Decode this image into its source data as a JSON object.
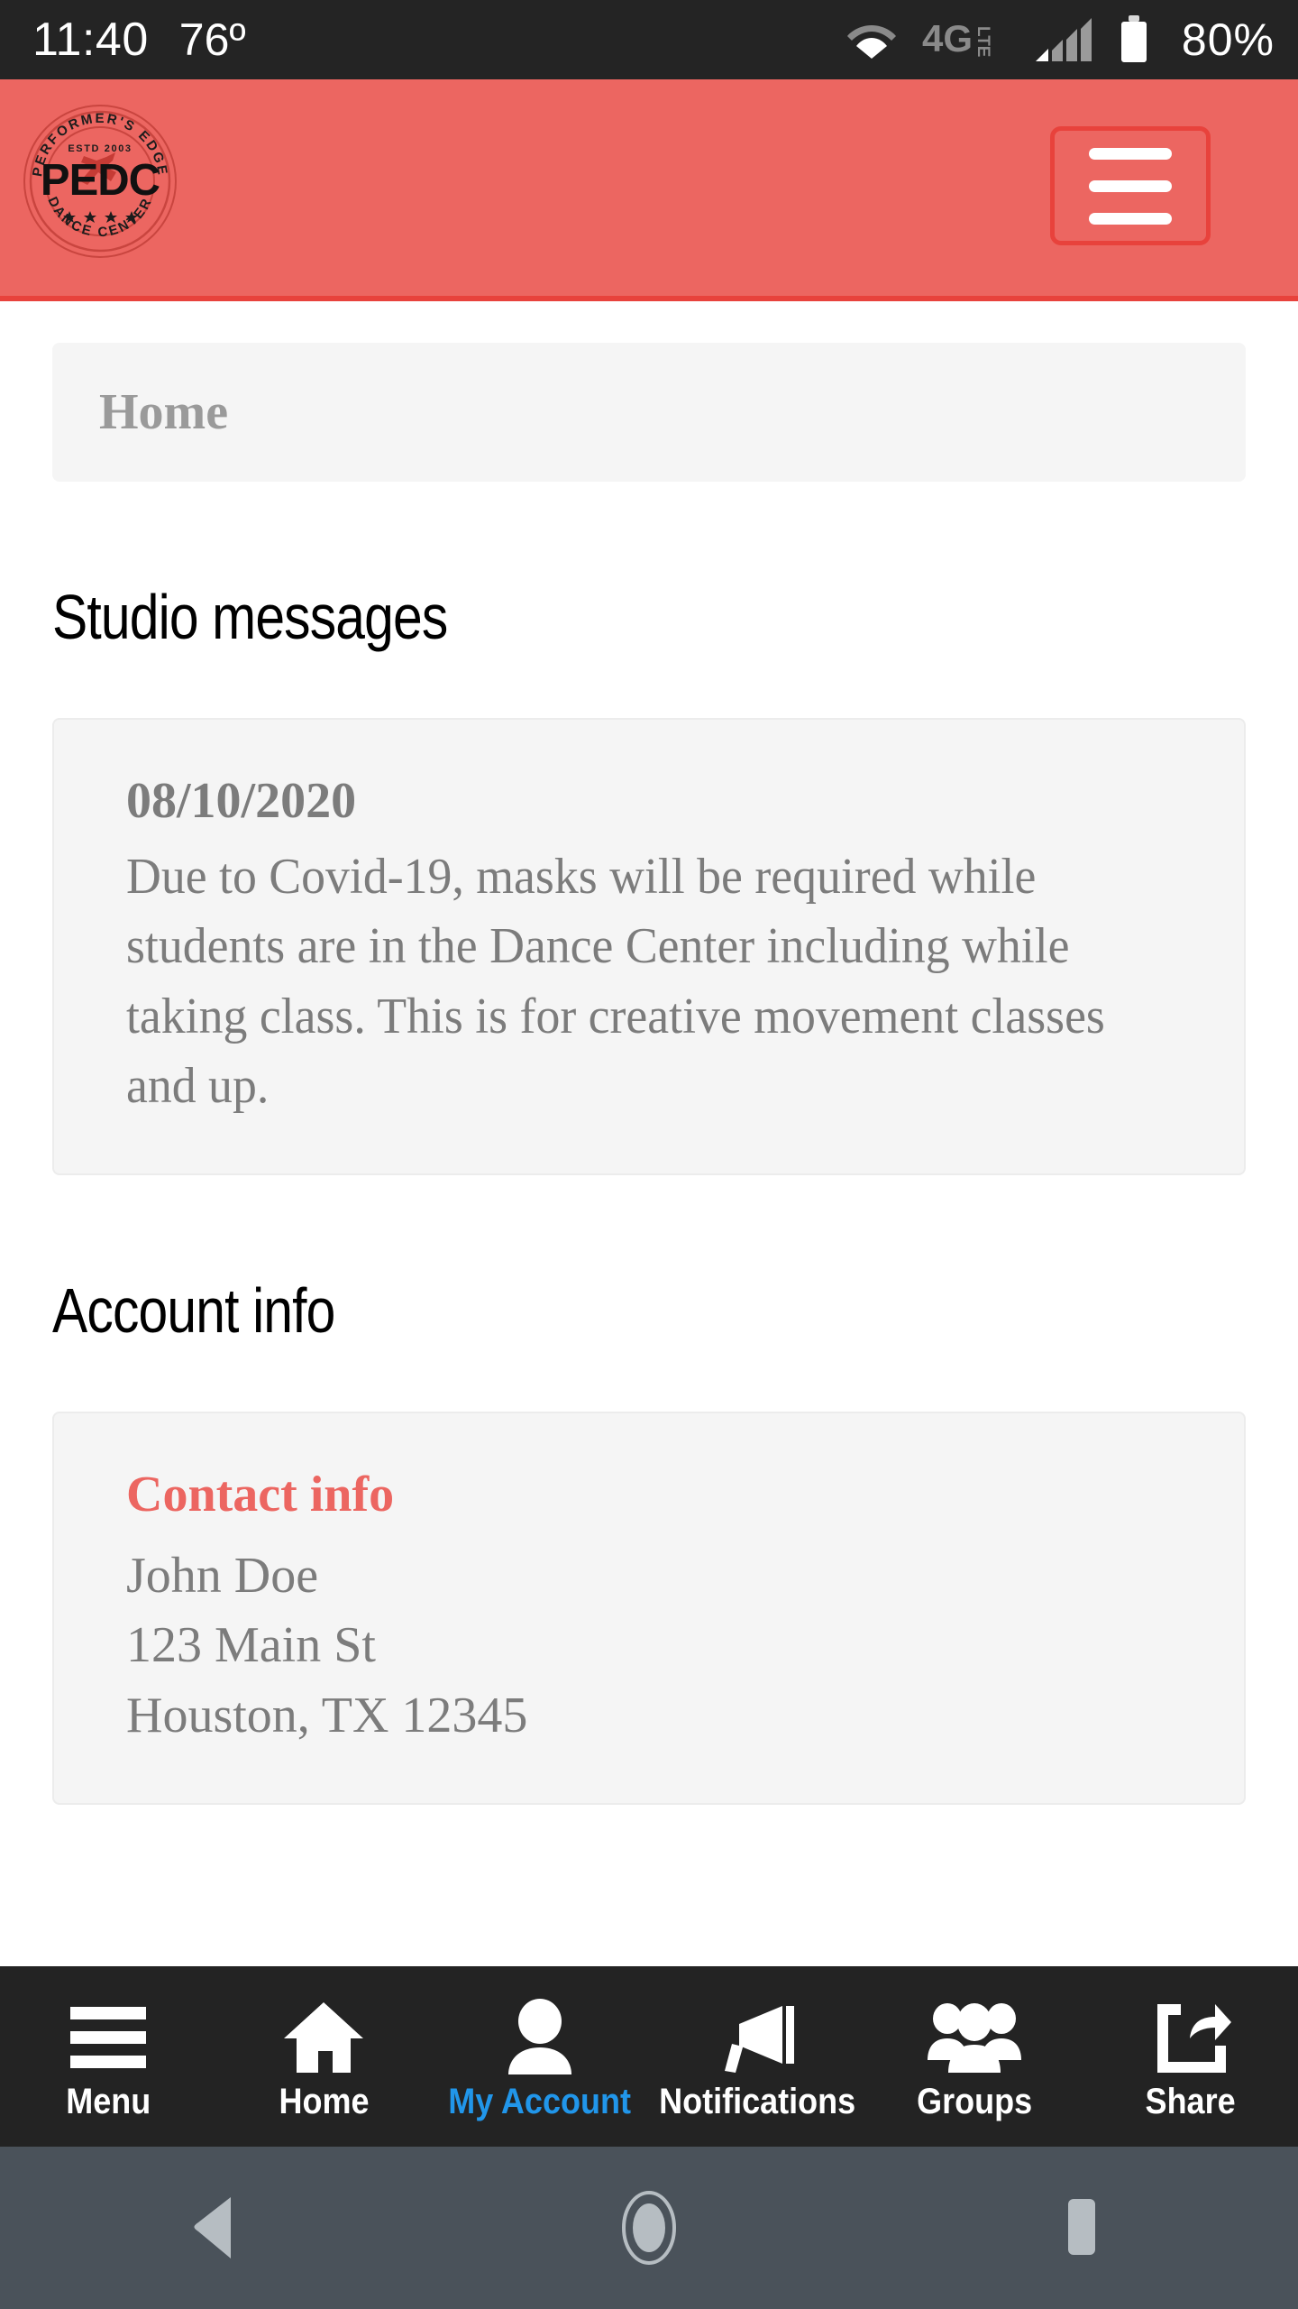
{
  "status_bar": {
    "time": "11:40",
    "temperature": "76º",
    "battery_percent": "80%",
    "network_label": "4G",
    "network_sub": "LTE",
    "icons": {
      "wifi": "wifi-icon",
      "network": "4g-lte-icon",
      "signal": "signal-bars-icon",
      "battery": "battery-icon"
    },
    "bg_color": "#242424"
  },
  "app_header": {
    "bg_color": "#ec6661",
    "border_color": "#e8423c",
    "logo": {
      "name": "pedc-logo",
      "initials": "PEDC",
      "top_arc": "PERFORMER'S EDGE",
      "bottom_arc": "DANCE CENTER",
      "established": "ESTD 2003",
      "stars": 4
    },
    "menu_button_label": "Menu"
  },
  "breadcrumb": {
    "label": "Home"
  },
  "sections": [
    {
      "title": "Studio messages",
      "card": {
        "date": "08/10/2020",
        "body": "Due to Covid-19, masks will be required while students are in the Dance Center including while taking class. This is for creative movement classes and up."
      }
    },
    {
      "title": "Account info",
      "card": {
        "heading": "Contact info",
        "heading_color": "#ec6661",
        "lines": [
          "John Doe",
          "123 Main St",
          "Houston, TX 12345"
        ]
      }
    }
  ],
  "bottom_nav": {
    "active_color": "#2196ea",
    "bg_color": "#232323",
    "items": [
      {
        "label": "Menu",
        "icon": "hamburger-icon",
        "active": false
      },
      {
        "label": "Home",
        "icon": "house-icon",
        "active": false
      },
      {
        "label": "My Account",
        "icon": "person-icon",
        "active": true
      },
      {
        "label": "Notifications",
        "icon": "megaphone-icon",
        "active": false
      },
      {
        "label": "Groups",
        "icon": "people-group-icon",
        "active": false
      },
      {
        "label": "Share",
        "icon": "share-arrow-icon",
        "active": false
      }
    ]
  },
  "system_nav": {
    "bg_color": "#4a525a",
    "buttons": [
      {
        "name": "back-button",
        "icon": "triangle-back-icon"
      },
      {
        "name": "home-button",
        "icon": "circle-home-icon"
      },
      {
        "name": "recents-button",
        "icon": "square-recents-icon"
      }
    ]
  }
}
